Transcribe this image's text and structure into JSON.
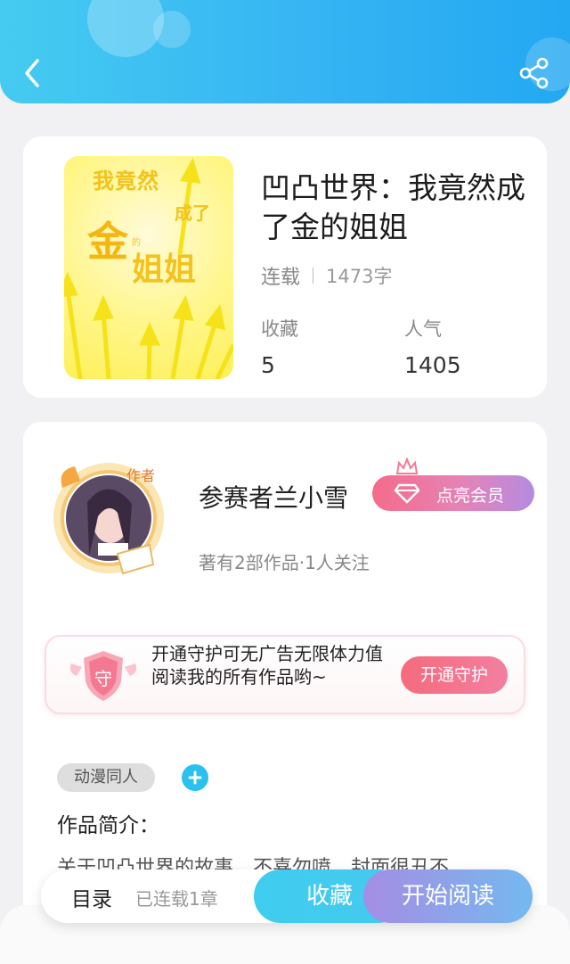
{
  "header": {
    "back_icon": "chevron-left-icon",
    "share_icon": "share-icon"
  },
  "book": {
    "title": "凹凸世界：我竟然成了金的姐姐",
    "status": "连载",
    "word_count": "1473字",
    "favorites_label": "收藏",
    "favorites_value": "5",
    "popularity_label": "人气",
    "popularity_value": "1405",
    "cover_text": {
      "line1": "我竟然",
      "line2": "成了",
      "line3": "金",
      "line4": "的",
      "line5": "姐姐"
    }
  },
  "author": {
    "badge": "作者",
    "name": "参赛者兰小雪",
    "vip_label": "点亮会员",
    "stats": "著有2部作品·1人关注"
  },
  "guard": {
    "shield_text": "守",
    "message": "开通守护可无广告无限体力值阅读我的所有作品哟~",
    "button": "开通守护"
  },
  "tags": [
    "动漫同人"
  ],
  "intro": {
    "label": "作品简介：",
    "text": "关于凹凸世界的故事，不喜勿喷，封面很丑不"
  },
  "bottom": {
    "toc": "目录",
    "chapters": "已连载1章",
    "favorite": "收藏",
    "start_reading": "开始阅读"
  },
  "colors": {
    "header_start": "#45cbf1",
    "header_end": "#23a8f2",
    "vip_gradient_start": "#f56b8a",
    "vip_gradient_end": "#b48be0",
    "guard_button": "#f56b7d",
    "tag_add": "#2ac0f0"
  }
}
